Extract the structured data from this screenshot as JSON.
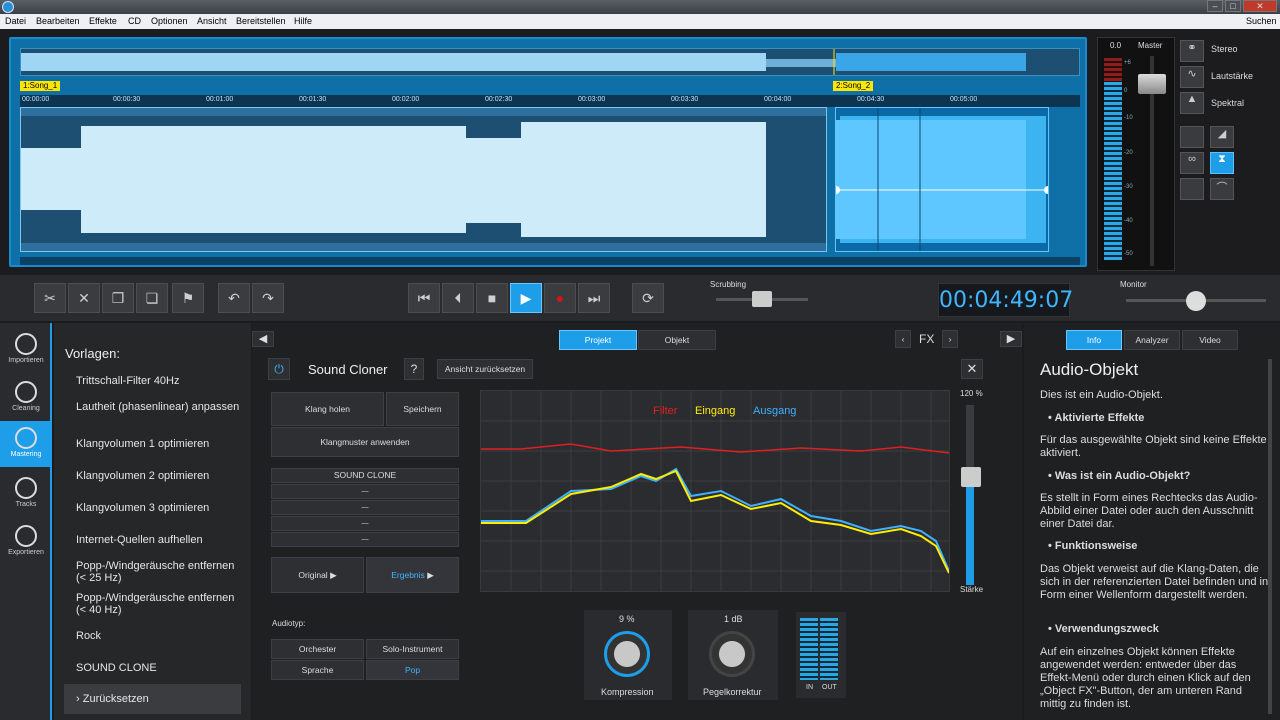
{
  "menu": [
    "Datei",
    "Bearbeiten",
    "Effekte",
    "CD",
    "Optionen",
    "Ansicht",
    "Bereitstellen",
    "Hilfe"
  ],
  "search": "Suchen",
  "timeline": {
    "ticks": [
      "00:00:00",
      "00:00:30",
      "00:01:00",
      "00:01:30",
      "00:02:00",
      "00:02:30",
      "00:03:00",
      "00:03:30",
      "00:04:00",
      "00:04:30",
      "00:05:00"
    ],
    "clip1": "1:Song_1",
    "clip2": "2:Song_2"
  },
  "meter": {
    "value": "0.0",
    "label": "Master",
    "scale": [
      "+6",
      "0",
      "-10",
      "-20",
      "-30",
      "-40",
      "-50"
    ]
  },
  "views": [
    "Stereo",
    "Lautstärke",
    "Spektral"
  ],
  "transport": {
    "scrubbing": "Scrubbing",
    "monitor": "Monitor",
    "time": "00:04:49:07"
  },
  "sidebar": [
    "Importieren",
    "Cleaning",
    "Mastering",
    "Tracks",
    "Exportieren"
  ],
  "presets": {
    "title": "Vorlagen:",
    "items": [
      "Trittschall-Filter 40Hz",
      "Lautheit (phasenlinear) anpassen",
      "Klangvolumen 1 optimieren",
      "Klangvolumen 2 optimieren",
      "Klangvolumen 3 optimieren",
      "Internet-Quellen aufhellen",
      "Popp-/Windgeräusche entfernen (< 25 Hz)",
      "Popp-/Windgeräusche entfernen (< 40 Hz)",
      "Rock",
      "SOUND CLONE",
      "Zurücksetzen"
    ]
  },
  "main": {
    "tabs": [
      "Projekt",
      "Objekt"
    ],
    "fx": "FX",
    "title": "Sound Cloner",
    "help": "?",
    "reset_view": "Ansicht zurücksetzen",
    "klang_holen": "Klang holen",
    "speichern": "Speichern",
    "klangmuster": "Klangmuster anwenden",
    "sound_clone": "SOUND CLONE",
    "slots": [
      "—",
      "—",
      "—",
      "—"
    ],
    "original": "Original",
    "ergebnis": "Ergebnis",
    "audiotyp": "Audiotyp:",
    "types": [
      "Orchester",
      "Solo-Instrument",
      "Sprache",
      "Pop"
    ],
    "legend": {
      "filter": "Filter",
      "eingang": "Eingang",
      "ausgang": "Ausgang"
    },
    "strength": {
      "value": "120 %",
      "label": "Stärke"
    },
    "knobs": [
      {
        "value": "9 %",
        "label": "Kompression"
      },
      {
        "value": "1 dB",
        "label": "Pegelkorrektur"
      }
    ],
    "inout": [
      "IN",
      "OUT"
    ]
  },
  "info": {
    "tabs": [
      "Info",
      "Analyzer",
      "Video"
    ],
    "title": "Audio-Objekt",
    "p1": "Dies ist ein Audio-Objekt.",
    "h1": "• Aktivierte Effekte",
    "p2": "Für das ausgewählte Objekt sind keine Effekte aktiviert.",
    "h2": "• Was ist ein Audio-Objekt?",
    "p3": "Es stellt in Form eines Rechtecks das Audio-Abbild einer Datei oder auch den Ausschnitt einer Datei dar.",
    "h3": "• Funktionsweise",
    "p4": "Das Objekt verweist auf die Klang-Daten, die sich in der referenzierten Datei befinden und in Form einer Wellenform dargestellt werden.",
    "h4": "• Verwendungszweck",
    "p5": "Auf ein einzelnes Objekt können Effekte angewendet werden: entweder über das Effekt-Menü oder durch einen Klick auf den „Object FX\"-Button, der am unteren Rand mittig zu finden ist."
  },
  "colors": {
    "accent": "#1e9ee8",
    "filter": "#e02020",
    "eingang": "#ffee00",
    "ausgang": "#3fb0ff"
  }
}
